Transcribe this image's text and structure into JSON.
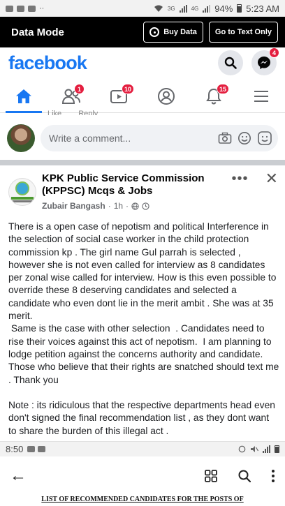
{
  "status_bar": {
    "right_signal": "3G",
    "right_signal2": "4G",
    "battery": "94%",
    "time": "5:23 AM"
  },
  "data_bar": {
    "title": "Data Mode",
    "buy_label": "Buy Data",
    "text_mode_label": "Go to Text Only"
  },
  "header": {
    "logo": "facebook",
    "messenger_badge": "4"
  },
  "nav": {
    "friends_badge": "1",
    "watch_badge": "10",
    "notifications_badge": "15"
  },
  "prev_post": {
    "like_label": "Like",
    "reply_label": "Reply"
  },
  "comment": {
    "placeholder": "Write a comment..."
  },
  "post": {
    "page_name": "KPK Public Service Commission (KPPSC) Mcqs & Jobs",
    "author": "Zubair Bangash",
    "time": "1h",
    "paragraphs": [
      "There is a open case of nepotism and political Interference in the selection of social case worker in the child protection commission kp . The girl name Gul parrah is selected , however she is not even called for interview as  8 candidates per zonal wise called for interview.  How is this even possible to override these 8 deserving candidates and selected a candidate who even dont lie in the merit ambit . She was at 35 merit.",
      " Same is the case with other selection  . Candidates need to rise their voices against this act of nepotism.  I am planning to lodge petition against the concerns authority and candidate.  Those who believe that their rights are snatched should text me  . Thank you",
      "Note : its ridiculous that the respective departments head even don't signed the final recommendation list , as they dont want to share the burden of this illegal act ."
    ]
  },
  "bottom_status": {
    "time": "8:50"
  },
  "bottom_doc": "LIST OF RECOMMENDED CANDIDATES FOR THE POSTS OF",
  "colors": {
    "brand": "#1877f2",
    "badge": "#e41e3f"
  }
}
